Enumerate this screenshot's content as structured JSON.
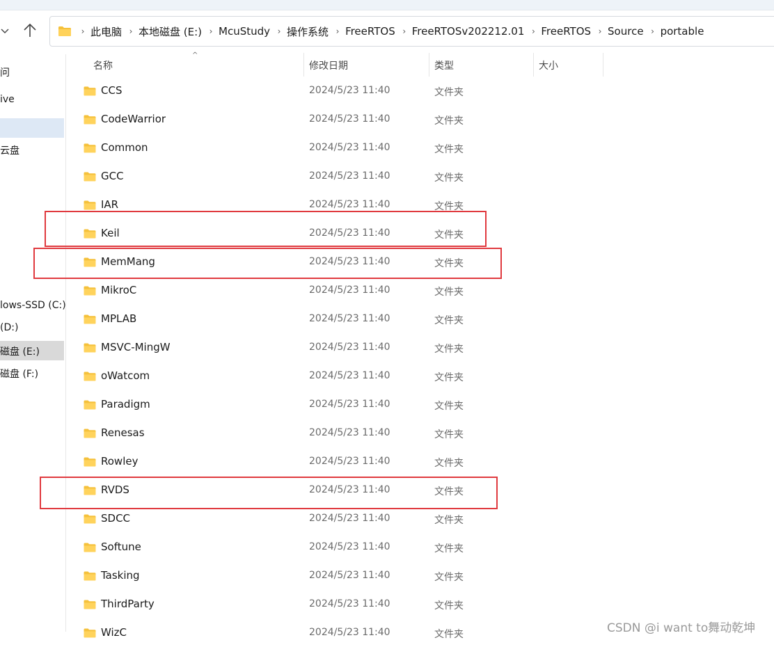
{
  "navigation": {
    "breadcrumbs": [
      "此电脑",
      "本地磁盘 (E:)",
      "McuStudy",
      "操作系统",
      "FreeRTOS",
      "FreeRTOSv202212.01",
      "FreeRTOS",
      "Source",
      "portable"
    ]
  },
  "sidebar": {
    "items": [
      {
        "label": "问"
      },
      {
        "label": "ive"
      },
      {
        "label": "云盘"
      },
      {
        "label": "lows-SSD (C:)"
      },
      {
        "label": "(D:)"
      },
      {
        "label": "磁盘 (E:)"
      },
      {
        "label": "磁盘 (F:)"
      }
    ]
  },
  "columns": {
    "name": "名称",
    "date": "修改日期",
    "type": "类型",
    "size": "大小"
  },
  "files": [
    {
      "name": "CCS",
      "date": "2024/5/23 11:40",
      "type": "文件夹"
    },
    {
      "name": "CodeWarrior",
      "date": "2024/5/23 11:40",
      "type": "文件夹"
    },
    {
      "name": "Common",
      "date": "2024/5/23 11:40",
      "type": "文件夹"
    },
    {
      "name": "GCC",
      "date": "2024/5/23 11:40",
      "type": "文件夹"
    },
    {
      "name": "IAR",
      "date": "2024/5/23 11:40",
      "type": "文件夹"
    },
    {
      "name": "Keil",
      "date": "2024/5/23 11:40",
      "type": "文件夹"
    },
    {
      "name": "MemMang",
      "date": "2024/5/23 11:40",
      "type": "文件夹"
    },
    {
      "name": "MikroC",
      "date": "2024/5/23 11:40",
      "type": "文件夹"
    },
    {
      "name": "MPLAB",
      "date": "2024/5/23 11:40",
      "type": "文件夹"
    },
    {
      "name": "MSVC-MingW",
      "date": "2024/5/23 11:40",
      "type": "文件夹"
    },
    {
      "name": "oWatcom",
      "date": "2024/5/23 11:40",
      "type": "文件夹"
    },
    {
      "name": "Paradigm",
      "date": "2024/5/23 11:40",
      "type": "文件夹"
    },
    {
      "name": "Renesas",
      "date": "2024/5/23 11:40",
      "type": "文件夹"
    },
    {
      "name": "Rowley",
      "date": "2024/5/23 11:40",
      "type": "文件夹"
    },
    {
      "name": "RVDS",
      "date": "2024/5/23 11:40",
      "type": "文件夹"
    },
    {
      "name": "SDCC",
      "date": "2024/5/23 11:40",
      "type": "文件夹"
    },
    {
      "name": "Softune",
      "date": "2024/5/23 11:40",
      "type": "文件夹"
    },
    {
      "name": "Tasking",
      "date": "2024/5/23 11:40",
      "type": "文件夹"
    },
    {
      "name": "ThirdParty",
      "date": "2024/5/23 11:40",
      "type": "文件夹"
    },
    {
      "name": "WizC",
      "date": "2024/5/23 11:40",
      "type": "文件夹"
    }
  ],
  "highlighted_files": [
    "Keil",
    "MemMang",
    "RVDS"
  ],
  "watermark": "CSDN @i want to舞动乾坤",
  "colors": {
    "folder": "#f5c13b",
    "highlight_box": "#e0393e",
    "selection": "#dde8f5",
    "active_drive": "#d9d9d9"
  },
  "icons": {
    "folder": "folder-icon",
    "up": "arrow-up-icon",
    "back": "chevron-down-icon",
    "separator": "chevron-right-icon"
  }
}
